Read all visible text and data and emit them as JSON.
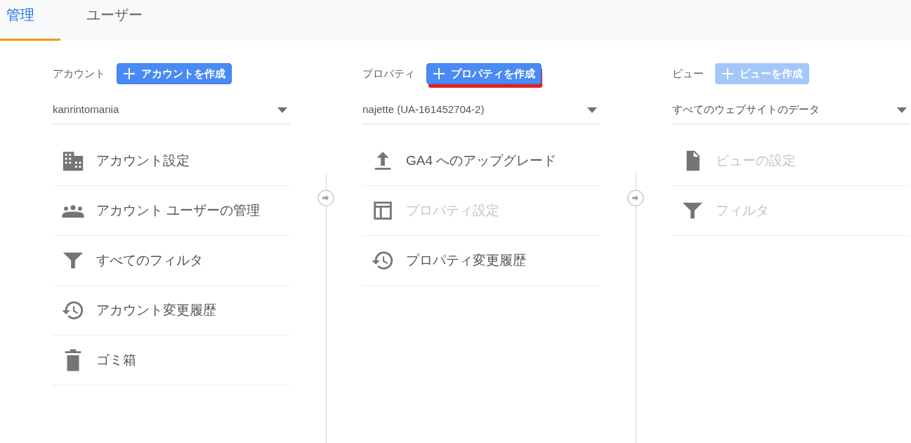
{
  "tabs": [
    {
      "label": "管理",
      "selected": true
    },
    {
      "label": "ユーザー",
      "selected": false
    }
  ],
  "columns": [
    {
      "label": "アカウント",
      "create_button": {
        "label": "アカウントを作成",
        "disabled": false,
        "underlined": false
      },
      "selector": {
        "value": "kanrintomania"
      },
      "items": [
        {
          "kind": "building",
          "label": "アカウント設定",
          "disabled": false
        },
        {
          "kind": "people",
          "label": "アカウント ユーザーの管理",
          "disabled": false
        },
        {
          "kind": "filter",
          "label": "すべてのフィルタ",
          "disabled": false
        },
        {
          "kind": "history",
          "label": "アカウント変更履歴",
          "disabled": false
        },
        {
          "kind": "trash",
          "label": "ゴミ箱",
          "disabled": false
        }
      ]
    },
    {
      "label": "プロパティ",
      "create_button": {
        "label": "プロパティを作成",
        "disabled": false,
        "underlined": true
      },
      "selector": {
        "value": "najette (UA-161452704-2)"
      },
      "items": [
        {
          "kind": "upload",
          "label": "GA4 へのアップグレード",
          "disabled": false
        },
        {
          "kind": "layout",
          "label": "プロパティ設定",
          "disabled": true
        },
        {
          "kind": "history",
          "label": "プロパティ変更履歴",
          "disabled": false
        }
      ]
    },
    {
      "label": "ビュー",
      "create_button": {
        "label": "ビューを作成",
        "disabled": true,
        "underlined": false
      },
      "selector": {
        "value": "すべてのウェブサイトのデータ"
      },
      "items": [
        {
          "kind": "document",
          "label": "ビューの設定",
          "disabled": true
        },
        {
          "kind": "filter",
          "label": "フィルタ",
          "disabled": true
        }
      ]
    }
  ]
}
